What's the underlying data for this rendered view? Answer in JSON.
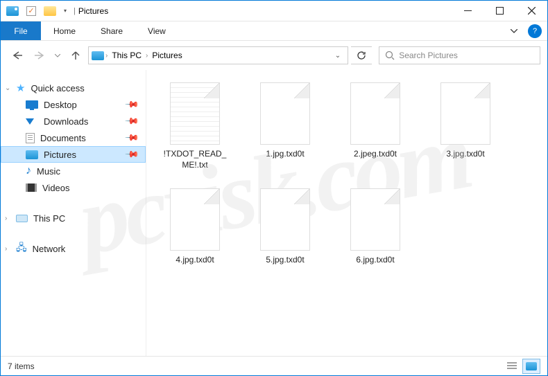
{
  "titlebar": {
    "title": "Pictures",
    "min_tooltip": "Minimize",
    "max_tooltip": "Maximize",
    "close_tooltip": "Close"
  },
  "ribbon": {
    "file": "File",
    "tabs": [
      "Home",
      "Share",
      "View"
    ]
  },
  "nav": {
    "breadcrumbs": [
      "This PC",
      "Pictures"
    ],
    "search_placeholder": "Search Pictures"
  },
  "sidebar": {
    "quick_access": "Quick access",
    "items": [
      {
        "label": "Desktop",
        "pinned": true,
        "icon": "desktop"
      },
      {
        "label": "Downloads",
        "pinned": true,
        "icon": "downloads"
      },
      {
        "label": "Documents",
        "pinned": true,
        "icon": "documents"
      },
      {
        "label": "Pictures",
        "pinned": true,
        "icon": "pictures",
        "selected": true
      },
      {
        "label": "Music",
        "pinned": false,
        "icon": "music"
      },
      {
        "label": "Videos",
        "pinned": false,
        "icon": "videos"
      }
    ],
    "this_pc": "This PC",
    "network": "Network"
  },
  "files": [
    {
      "name": "!TXDOT_READ_ME!.txt",
      "type": "txt"
    },
    {
      "name": "1.jpg.txd0t",
      "type": "unknown"
    },
    {
      "name": "2.jpeg.txd0t",
      "type": "unknown"
    },
    {
      "name": "3.jpg.txd0t",
      "type": "unknown"
    },
    {
      "name": "4.jpg.txd0t",
      "type": "unknown"
    },
    {
      "name": "5.jpg.txd0t",
      "type": "unknown"
    },
    {
      "name": "6.jpg.txd0t",
      "type": "unknown"
    }
  ],
  "status": {
    "count_text": "7 items"
  },
  "watermark": "pcrisk.com"
}
